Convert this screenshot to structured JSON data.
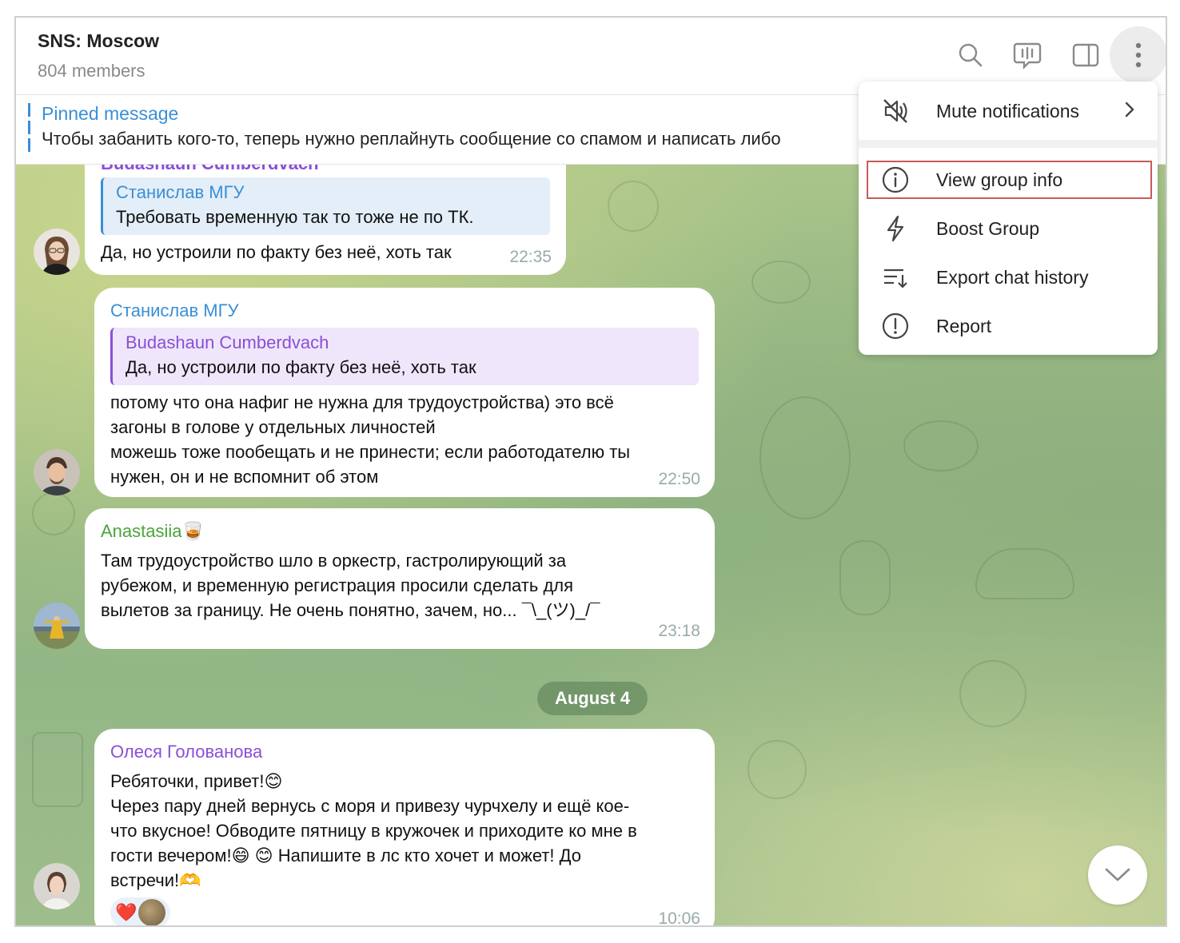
{
  "header": {
    "title": "SNS: Moscow",
    "subtitle": "804 members",
    "icons": [
      "search-icon",
      "voice-chat-icon",
      "sidebar-toggle-icon",
      "more-vertical-icon"
    ]
  },
  "pinned": {
    "label": "Pinned message",
    "text": "Чтобы забанить кого-то, теперь нужно реплайнуть сообщение со спамом и написать либо"
  },
  "messages": [
    {
      "sender": "Budashaun Cumberdvach",
      "reply": {
        "name": "Станислав МГУ",
        "text": "Требовать временную так то тоже не по ТК."
      },
      "text": "Да, но устроили по факту без неё, хоть так",
      "time": "22:35"
    },
    {
      "sender": "Станислав МГУ",
      "reply": {
        "name": "Budashaun Cumberdvach",
        "text": "Да, но устроили по факту без неё, хоть так"
      },
      "lines": [
        "потому что она нафиг не нужна для трудоустройства) это всё",
        "загоны в голове у отдельных личностей",
        "можешь тоже пообещать и не принести; если работодателю ты",
        "нужен, он и не вспомнит об этом"
      ],
      "time": "22:50"
    },
    {
      "sender": "Anastasiia🥃",
      "lines": [
        "Там трудоустройство шло в оркестр, гастролирующий за",
        "рубежом, и временную регистрация просили сделать для",
        "вылетов за границу. Не очень понятно, зачем, но... ¯\\_(ツ)_/¯"
      ],
      "time": "23:18"
    },
    {
      "sender": "Олеся Голованова",
      "lines": [
        "Ребяточки, привет!😊",
        "Через пару дней вернусь с моря и привезу чурчхелу и ещё кое-",
        "что вкусное! Обводите пятницу в кружочек и приходите ко мне в",
        "гости вечером!😄 😊  Напишите в лс кто хочет и может! До",
        "встречи!🫶"
      ],
      "reactions": "❤️",
      "time": "10:06"
    }
  ],
  "date_separator": "August 4",
  "menu": {
    "items": [
      {
        "label": "Mute notifications",
        "icon": "mute-icon"
      },
      {
        "label": "View group info",
        "icon": "info-icon"
      },
      {
        "label": "Boost Group",
        "icon": "boost-icon"
      },
      {
        "label": "Export chat history",
        "icon": "export-icon"
      },
      {
        "label": "Report",
        "icon": "report-icon"
      }
    ]
  },
  "colors": {
    "link_blue": "#3a8fd6",
    "purple": "#8a4fd6",
    "green_name": "#4aa43a",
    "highlight_border": "#c95a5a"
  }
}
